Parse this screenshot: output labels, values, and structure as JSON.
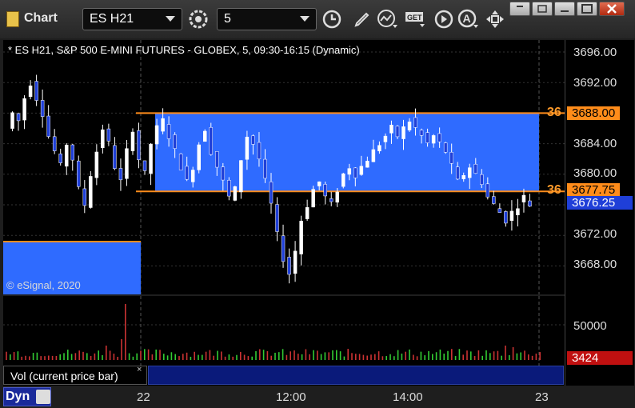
{
  "app": {
    "title": "Chart",
    "symbol": "ES H21",
    "interval": "5"
  },
  "icons": [
    "settings-gear-icon",
    "clock-icon",
    "pencil-icon",
    "study-icon",
    "get-icon",
    "play-icon",
    "alert-icon",
    "move-icon"
  ],
  "chart_header": "* ES H21, S&P 500 E-MINI FUTURES - GLOBEX, 5, 09:30-16:15 (Dynamic)",
  "copyright": "© eSignal, 2020",
  "price_axis": {
    "ticks": [
      "3696.00",
      "3692.00",
      "3688.00",
      "3684.00",
      "3680.00",
      "3676.00",
      "3672.00",
      "3668.00"
    ],
    "upper_line_tag": "3688.00",
    "lower_line_tag": "3677.75",
    "last_price_tag": "3676.25",
    "line_label_truncated": "36"
  },
  "volume_axis": {
    "tick": "50000",
    "current": "3424"
  },
  "volume_label": "Vol (current price bar)",
  "close_symbol": "×",
  "time_axis": [
    "22",
    "12:00",
    "14:00",
    "23"
  ],
  "status": "Dyn",
  "chart_data": {
    "type": "candlestick",
    "symbol": "ES H21",
    "ylim": [
      3664,
      3698
    ],
    "lines": [
      {
        "price": 3688.0,
        "color": "#ff8c1a"
      },
      {
        "price": 3677.75,
        "color": "#ff8c1a"
      }
    ],
    "highlight_zone": {
      "from": 3677.75,
      "to": 3688.0,
      "color": "#1a5cff"
    },
    "last_price": 3676.25,
    "volume_last": 3424,
    "colors": {
      "zone": "#2f6bff",
      "line": "#ff8c1a",
      "last": "#1f3fd8",
      "vol_tag": "#c01010"
    }
  }
}
